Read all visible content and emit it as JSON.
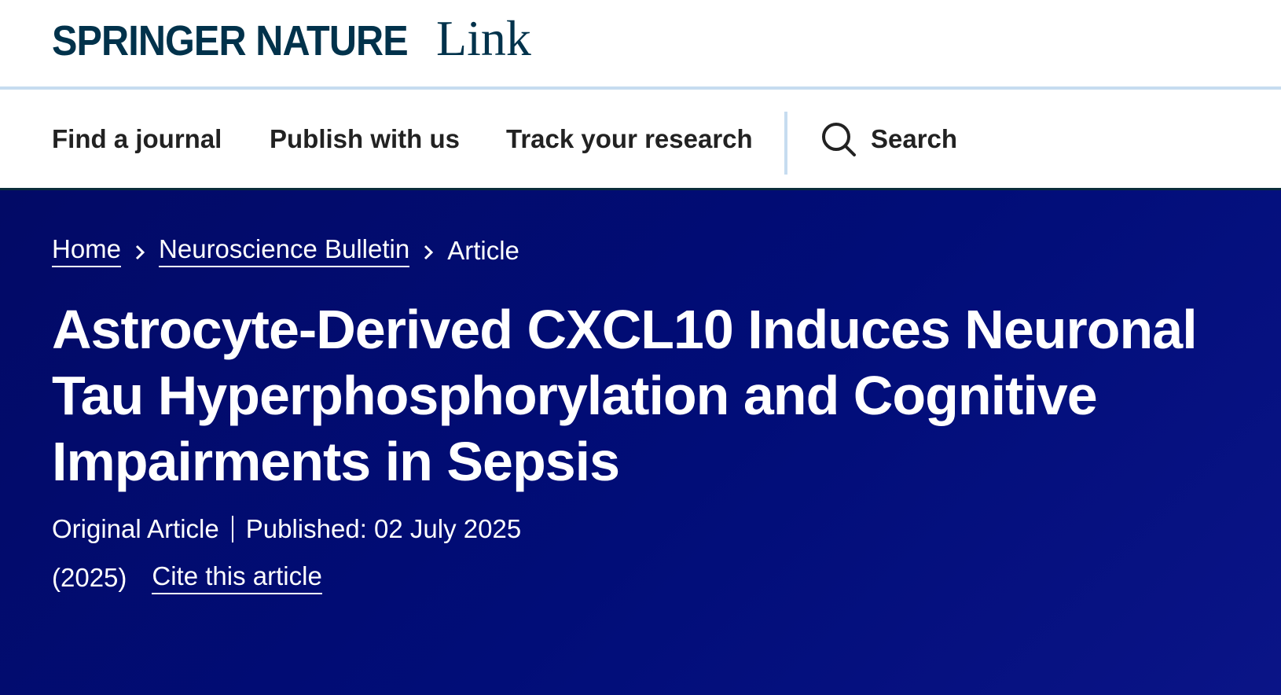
{
  "header": {
    "logo_brand": "SPRINGER NATURE",
    "logo_suffix": "Link"
  },
  "nav": {
    "find_journal": "Find a journal",
    "publish": "Publish with us",
    "track": "Track your research",
    "search": "Search",
    "search_icon": "search-icon"
  },
  "breadcrumb": {
    "home": "Home",
    "journal": "Neuroscience Bulletin",
    "current": "Article",
    "separator_icon": "chevron-right-icon"
  },
  "article": {
    "title": "Astrocyte-Derived CXCL10 Induces Neuronal Tau Hyperphosphorylation and Cognitive Impairments in Sepsis",
    "type": "Original Article",
    "published": "Published: 02 July 2025",
    "year": "(2025)",
    "cite": "Cite this article"
  },
  "colors": {
    "brand": "#01324b",
    "hero_bg": "#010d78",
    "nav_text": "#222222",
    "divider": "#c6dcf0"
  }
}
